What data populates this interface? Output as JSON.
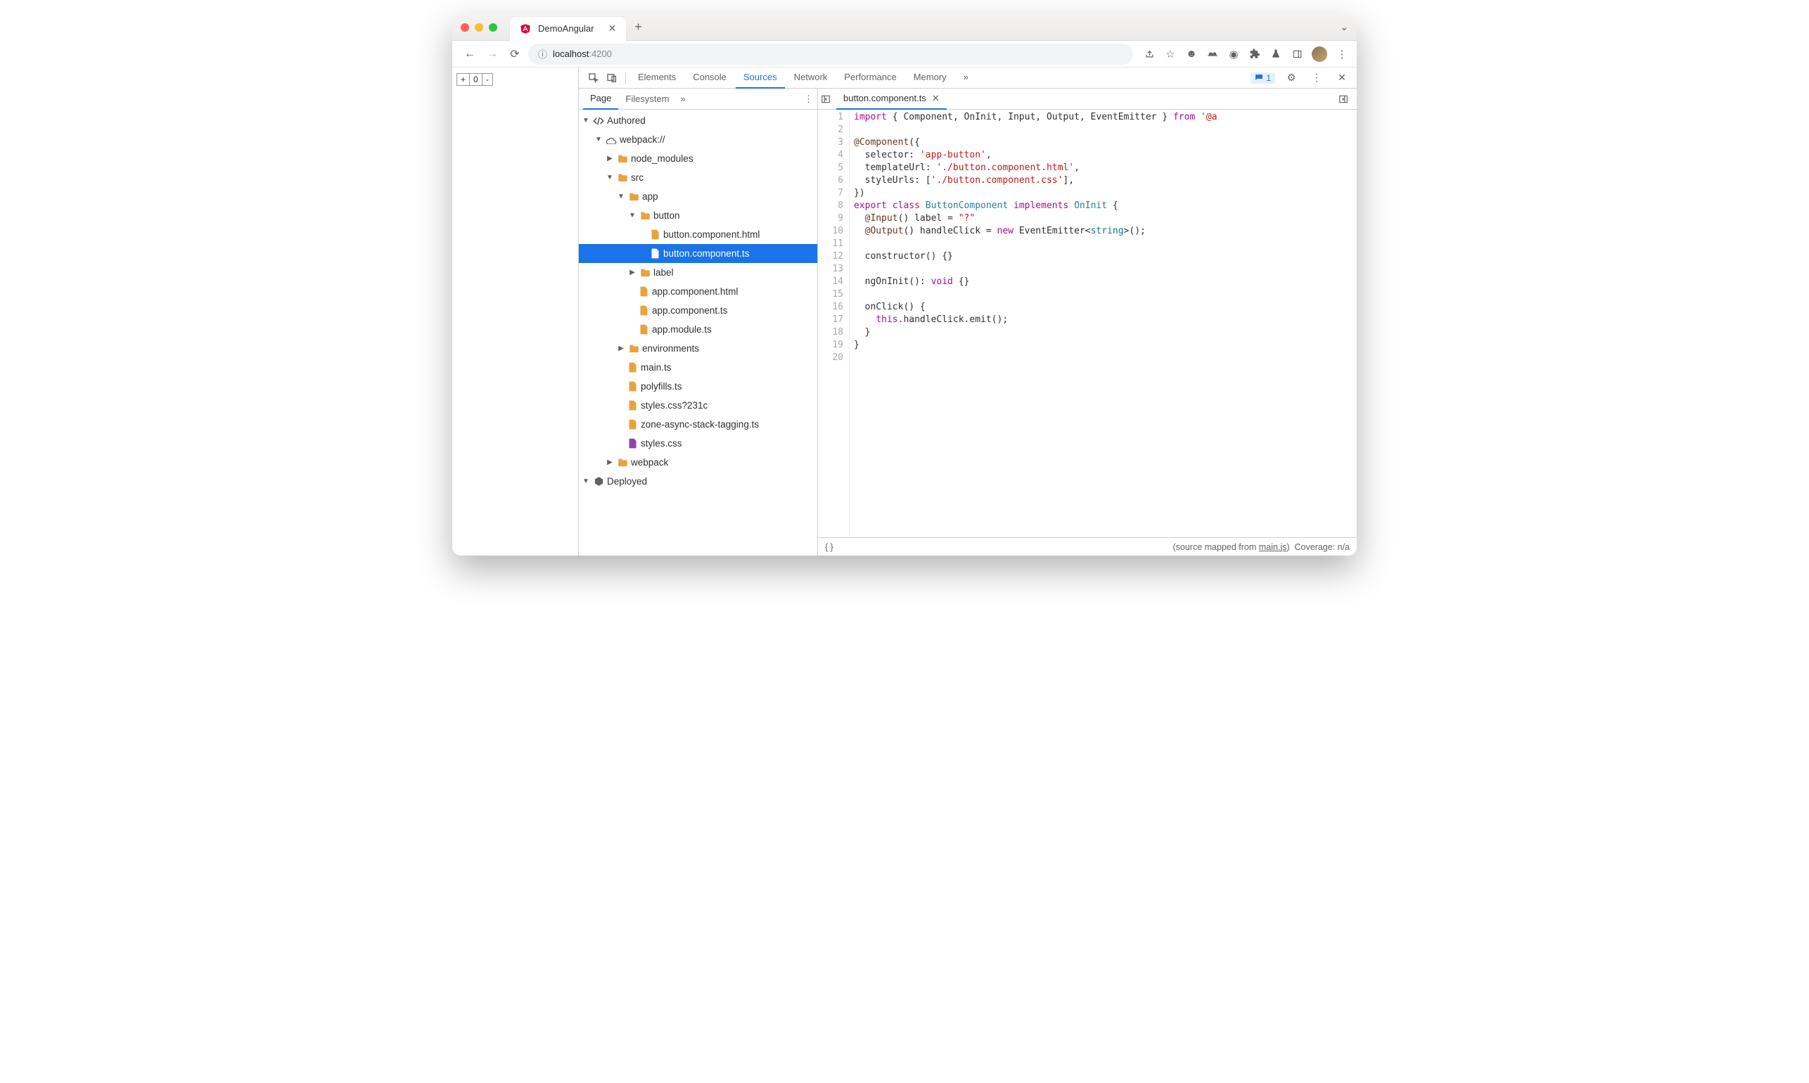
{
  "browser": {
    "tab_title": "DemoAngular",
    "url_host": "localhost",
    "url_port": ":4200",
    "counter_value": "0"
  },
  "devtools": {
    "tabs": [
      "Elements",
      "Console",
      "Sources",
      "Network",
      "Performance",
      "Memory"
    ],
    "active_tab": "Sources",
    "issues_count": "1",
    "nav_tabs": [
      "Page",
      "Filesystem"
    ],
    "tree": {
      "authored": "Authored",
      "webpack": "webpack://",
      "node_modules": "node_modules",
      "src": "src",
      "app": "app",
      "button": "button",
      "button_html": "button.component.html",
      "button_ts": "button.component.ts",
      "label": "label",
      "app_html": "app.component.html",
      "app_ts": "app.component.ts",
      "app_module": "app.module.ts",
      "environments": "environments",
      "main_ts": "main.ts",
      "polyfills": "polyfills.ts",
      "styles_hash": "styles.css?231c",
      "zone": "zone-async-stack-tagging.ts",
      "styles": "styles.css",
      "webpack_folder": "webpack",
      "deployed": "Deployed"
    },
    "open_file": "button.component.ts",
    "status_mapped": "(source mapped from ",
    "status_mapped_link": "main.js",
    "status_mapped_end": ")",
    "coverage": "Coverage: n/a"
  },
  "code": {
    "lines": 20,
    "l1a": "import",
    "l1b": " { Component, OnInit, Input, Output, EventEmitter } ",
    "l1c": "from",
    "l1d": " '@a",
    "l3": "@Component",
    "l3b": "({",
    "l4a": "  selector: ",
    "l4b": "'app-button'",
    "l4c": ",",
    "l5a": "  templateUrl: ",
    "l5b": "'./button.component.html'",
    "l5c": ",",
    "l6a": "  styleUrls: [",
    "l6b": "'./button.component.css'",
    "l6c": "],",
    "l7": "})",
    "l8a": "export",
    "l8b": " class ",
    "l8c": "ButtonComponent",
    "l8d": " implements ",
    "l8e": "OnInit",
    "l8f": " {",
    "l9a": "  @Input",
    "l9b": "() label = ",
    "l9c": "\"?\"",
    "l10a": "  @Output",
    "l10b": "() handleClick = ",
    "l10c": "new",
    "l10d": " EventEmitter<",
    "l10e": "string",
    "l10f": ">();",
    "l12": "  constructor() {}",
    "l14a": "  ngOnInit(): ",
    "l14b": "void",
    "l14c": " {}",
    "l16": "  onClick() {",
    "l17a": "    ",
    "l17b": "this",
    "l17c": ".handleClick.emit();",
    "l18": "  }",
    "l19": "}"
  }
}
